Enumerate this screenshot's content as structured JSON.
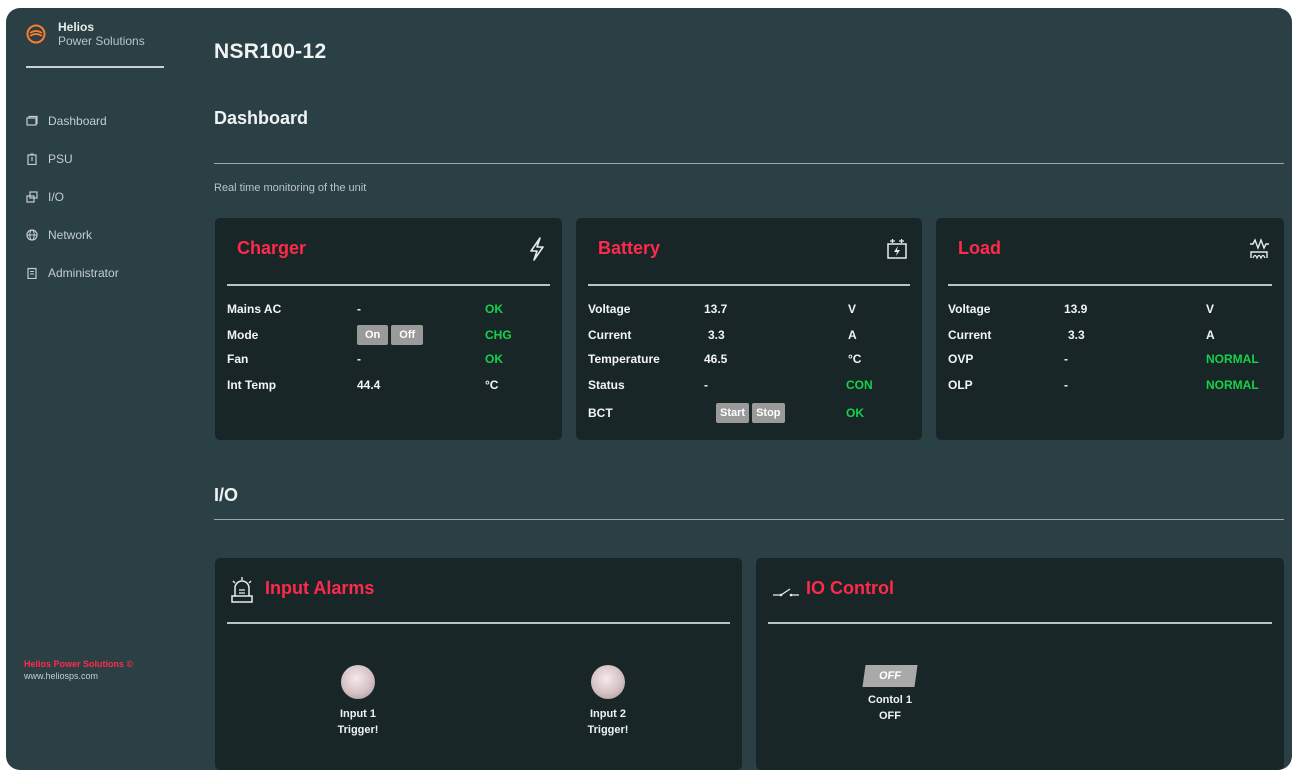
{
  "brand": {
    "name": "Helios",
    "subtitle": "Power Solutions"
  },
  "nav": [
    {
      "label": "Dashboard",
      "icon": "dashboard-icon"
    },
    {
      "label": "PSU",
      "icon": "battery-icon"
    },
    {
      "label": "I/O",
      "icon": "io-icon"
    },
    {
      "label": "Network",
      "icon": "globe-icon"
    },
    {
      "label": "Administrator",
      "icon": "clipboard-icon"
    }
  ],
  "footer": {
    "brand": "Helios Power Solutions ©",
    "url": "www.heliosps.com"
  },
  "page": {
    "title": "NSR100-12",
    "dashboard_heading": "Dashboard",
    "subtitle": "Real time monitoring of the unit",
    "io_heading": "I/O"
  },
  "charger": {
    "title": "Charger",
    "icon": "lightning-icon",
    "rows": [
      {
        "label": "Mains AC",
        "value": "-",
        "status": "OK"
      },
      {
        "label": "Mode",
        "buttons": [
          "On",
          "Off"
        ],
        "status": "CHG"
      },
      {
        "label": "Fan",
        "value": "-",
        "status": "OK"
      },
      {
        "label": "Int Temp",
        "value": "44.4",
        "unit": "°C"
      }
    ]
  },
  "battery": {
    "title": "Battery",
    "icon": "battery-charge-icon",
    "rows": [
      {
        "label": "Voltage",
        "value": "13.7",
        "unit": "V"
      },
      {
        "label": "Current",
        "value": "3.3",
        "unit": "A"
      },
      {
        "label": "Temperature",
        "value": "46.5",
        "unit": "°C"
      },
      {
        "label": "Status",
        "value": "-",
        "status": "CON"
      },
      {
        "label": "BCT",
        "buttons": [
          "Start",
          "Stop"
        ],
        "status": "OK"
      }
    ]
  },
  "load": {
    "title": "Load",
    "icon": "resistor-icon",
    "rows": [
      {
        "label": "Voltage",
        "value": "13.9",
        "unit": "V"
      },
      {
        "label": "Current",
        "value": "3.3",
        "unit": "A"
      },
      {
        "label": "OVP",
        "value": "-",
        "status": "NORMAL"
      },
      {
        "label": "OLP",
        "value": "-",
        "status": "NORMAL"
      }
    ]
  },
  "input_alarms": {
    "title": "Input Alarms",
    "icon": "alarm-siren-icon",
    "inputs": [
      {
        "name": "Input 1",
        "state": "Trigger!"
      },
      {
        "name": "Input 2",
        "state": "Trigger!"
      }
    ]
  },
  "io_control": {
    "title": "IO Control",
    "icon": "switch-icon",
    "controls": [
      {
        "toggle_label": "OFF",
        "name": "Contol 1",
        "state": "OFF"
      }
    ]
  },
  "colors": {
    "background": "#2b4045",
    "card": "#182628",
    "accent": "#ff2a4b",
    "ok": "#16d24a"
  }
}
